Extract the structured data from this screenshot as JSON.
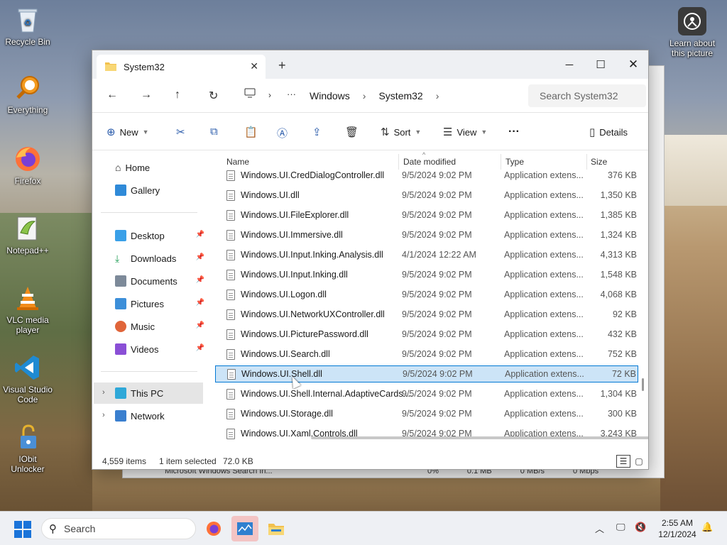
{
  "desktop": {
    "icons": [
      {
        "label": "Recycle Bin"
      },
      {
        "label": "Everything"
      },
      {
        "label": "Firefox"
      },
      {
        "label": "Notepad++"
      },
      {
        "label": "VLC media player"
      },
      {
        "label": "Visual Studio Code"
      },
      {
        "label": "IObit Unlocker"
      }
    ],
    "learn_about": "Learn about this picture"
  },
  "background_window": {
    "row_name": "Microsoft Windows Search In...",
    "cpu": "0%",
    "memory": "0.1 MB",
    "disk": "0 MB/s",
    "network": "0 Mbps"
  },
  "explorer": {
    "tab_title": "System32",
    "breadcrumbs": [
      "Windows",
      "System32"
    ],
    "search_placeholder": "Search System32",
    "toolbar": {
      "new": "New",
      "sort": "Sort",
      "view": "View",
      "details": "Details"
    },
    "sidebar": {
      "home": "Home",
      "gallery": "Gallery",
      "quick": [
        "Desktop",
        "Downloads",
        "Documents",
        "Pictures",
        "Music",
        "Videos"
      ],
      "this_pc": "This PC",
      "network": "Network"
    },
    "columns": {
      "name": "Name",
      "date": "Date modified",
      "type": "Type",
      "size": "Size"
    },
    "files": [
      {
        "name": "Windows.UI.CredDialogController.dll",
        "date": "9/5/2024 9:02 PM",
        "type": "Application extens...",
        "size": "376 KB"
      },
      {
        "name": "Windows.UI.dll",
        "date": "9/5/2024 9:02 PM",
        "type": "Application extens...",
        "size": "1,350 KB"
      },
      {
        "name": "Windows.UI.FileExplorer.dll",
        "date": "9/5/2024 9:02 PM",
        "type": "Application extens...",
        "size": "1,385 KB"
      },
      {
        "name": "Windows.UI.Immersive.dll",
        "date": "9/5/2024 9:02 PM",
        "type": "Application extens...",
        "size": "1,324 KB"
      },
      {
        "name": "Windows.UI.Input.Inking.Analysis.dll",
        "date": "4/1/2024 12:22 AM",
        "type": "Application extens...",
        "size": "4,313 KB"
      },
      {
        "name": "Windows.UI.Input.Inking.dll",
        "date": "9/5/2024 9:02 PM",
        "type": "Application extens...",
        "size": "1,548 KB"
      },
      {
        "name": "Windows.UI.Logon.dll",
        "date": "9/5/2024 9:02 PM",
        "type": "Application extens...",
        "size": "4,068 KB"
      },
      {
        "name": "Windows.UI.NetworkUXController.dll",
        "date": "9/5/2024 9:02 PM",
        "type": "Application extens...",
        "size": "92 KB"
      },
      {
        "name": "Windows.UI.PicturePassword.dll",
        "date": "9/5/2024 9:02 PM",
        "type": "Application extens...",
        "size": "432 KB"
      },
      {
        "name": "Windows.UI.Search.dll",
        "date": "9/5/2024 9:02 PM",
        "type": "Application extens...",
        "size": "752 KB"
      },
      {
        "name": "Windows.UI.Shell.dll",
        "date": "9/5/2024 9:02 PM",
        "type": "Application extens...",
        "size": "72 KB",
        "selected": true
      },
      {
        "name": "Windows.UI.Shell.Internal.AdaptiveCards....",
        "date": "9/5/2024 9:02 PM",
        "type": "Application extens...",
        "size": "1,304 KB"
      },
      {
        "name": "Windows.UI.Storage.dll",
        "date": "9/5/2024 9:02 PM",
        "type": "Application extens...",
        "size": "300 KB"
      },
      {
        "name": "Windows.UI.Xaml.Controls.dll",
        "date": "9/5/2024 9:02 PM",
        "type": "Application extens...",
        "size": "3,243 KB"
      }
    ],
    "status": {
      "items": "4,559 items",
      "selected": "1 item selected",
      "size": "72.0 KB"
    }
  },
  "taskbar": {
    "search_label": "Search",
    "time": "2:55 AM",
    "date": "12/1/2024"
  }
}
